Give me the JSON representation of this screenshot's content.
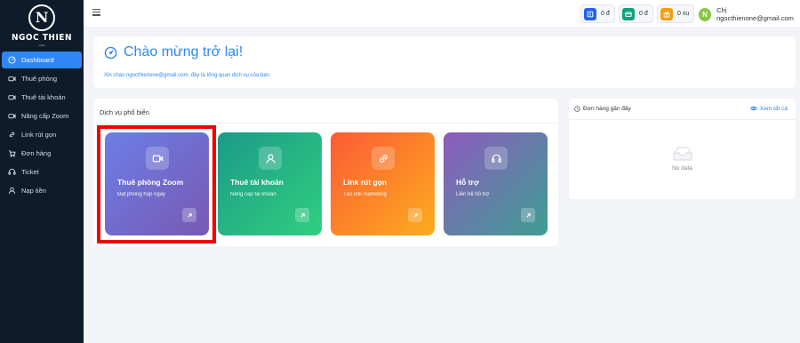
{
  "brand": {
    "logo_letter": "N",
    "name": "NGOC THIEN",
    "sub": "ONE"
  },
  "sidebar": {
    "items": [
      {
        "label": "Dashboard",
        "icon": "dashboard-icon",
        "active": true
      },
      {
        "label": "Thuê phòng",
        "icon": "video-icon"
      },
      {
        "label": "Thuê tài khoản",
        "icon": "video-icon"
      },
      {
        "label": "Nâng cấp Zoom",
        "icon": "video-icon"
      },
      {
        "label": "Link rút gọn",
        "icon": "link-icon"
      },
      {
        "label": "Đơn hàng",
        "icon": "cart-icon"
      },
      {
        "label": "Ticket",
        "icon": "headset-icon"
      },
      {
        "label": "Nạp tiền",
        "icon": "user-icon"
      }
    ]
  },
  "topbar": {
    "balances": [
      {
        "value": "0 đ",
        "icon": "wallet-icon",
        "color": "#2563eb"
      },
      {
        "value": "0 đ",
        "icon": "card-icon",
        "color": "#10a37f"
      },
      {
        "value": "0 xu",
        "icon": "gift-icon",
        "color": "#f59e0b"
      }
    ],
    "user": {
      "avatar": "N",
      "name": "Chị ngocthienone@gmail.com"
    }
  },
  "welcome": {
    "title": "Chào mừng trở lại!",
    "subtitle": "Xin chào ngocthienone@gmail.com, đây là tổng quan dịch vụ của bạn."
  },
  "services": {
    "title": "Dịch vụ phổ biến",
    "cards": [
      {
        "title": "Thuê phòng Zoom",
        "subtitle": "Đặt phòng họp ngay",
        "icon": "video-icon"
      },
      {
        "title": "Thuê tài khoản",
        "subtitle": "Nâng cấp tài khoản",
        "icon": "user-icon"
      },
      {
        "title": "Link rút gọn",
        "subtitle": "Tạo link marketing",
        "icon": "link-icon"
      },
      {
        "title": "Hỗ trợ",
        "subtitle": "Liên hệ hỗ trợ",
        "icon": "headset-icon"
      }
    ]
  },
  "orders": {
    "title": "Đơn hàng gần đây",
    "view_all": "Xem tất cả",
    "empty_text": "No data"
  },
  "colors": {
    "accent": "#2f86f6",
    "sidebar_bg": "#0d1b2a",
    "highlight": "#f10000"
  }
}
